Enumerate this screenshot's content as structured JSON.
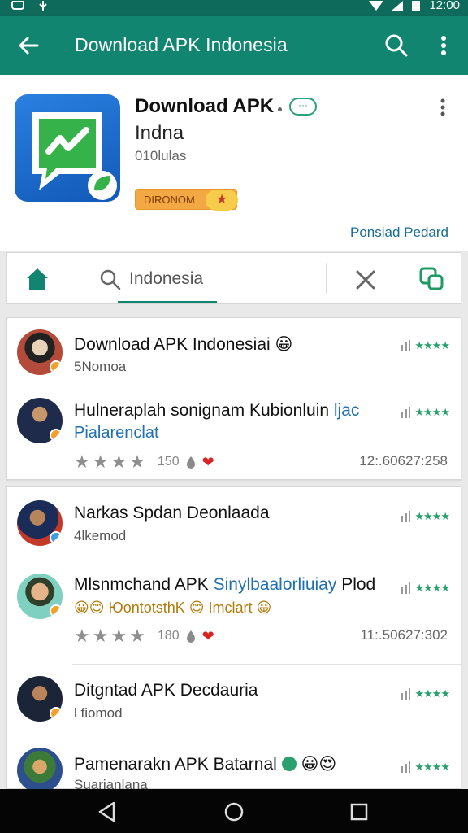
{
  "status_bar": {
    "time": "12:00"
  },
  "app_bar": {
    "title": "Download APK Indonesia",
    "back_icon": "arrow-left-icon",
    "search_icon": "search-icon",
    "more_icon": "more-vert-icon",
    "color": "#128570"
  },
  "app_card": {
    "name": "Download APK",
    "subtitle": "Indna",
    "meta": "010lulas",
    "tag_label": "DIRONOM",
    "tag_star": "★",
    "link": "Ponsiad Pedard",
    "icon": "chat-bubble-app-icon"
  },
  "tabs": {
    "home_icon": "home-icon",
    "search_text": "Indonesia",
    "close_icon": "close-icon",
    "copy_icon": "copy-icon"
  },
  "list": [
    {
      "title": "Download APK  Indonesiai 😀",
      "subtitle": "5Nomoa",
      "rating_stars": "★★★★"
    },
    {
      "title": "Hulneraplah sonignam Kubionluin",
      "title_suffix": "ljac",
      "subtitle": "Pialarenclat",
      "rating_stars": "★★★★",
      "star_count": "150",
      "id": "12:.60627:258"
    },
    {
      "title": "Narkas Spdan Deonlaada",
      "subtitle": "4lkemod",
      "rating_stars": "★★★★"
    },
    {
      "title": "Mlsnmchand APK",
      "title_suffix": "Sinylbaalorliuiay",
      "title_end": "Plod",
      "subtitle": "😀😊 ЮontotsthK 😊 Imclart 😀",
      "rating_stars": "★★★★",
      "star_count": "180",
      "id": "11:.50627:302"
    },
    {
      "title": "Ditgntad APK Decdauria",
      "subtitle": "l fiomod",
      "rating_stars": "★★★★"
    },
    {
      "title": "Pamenarakn APK Batarnal",
      "title_emoji": "😀😍",
      "subtitle": "Suarianlana",
      "rating_stars": "★★★★"
    }
  ],
  "grey_stars": "★★★★",
  "heart": "❤"
}
